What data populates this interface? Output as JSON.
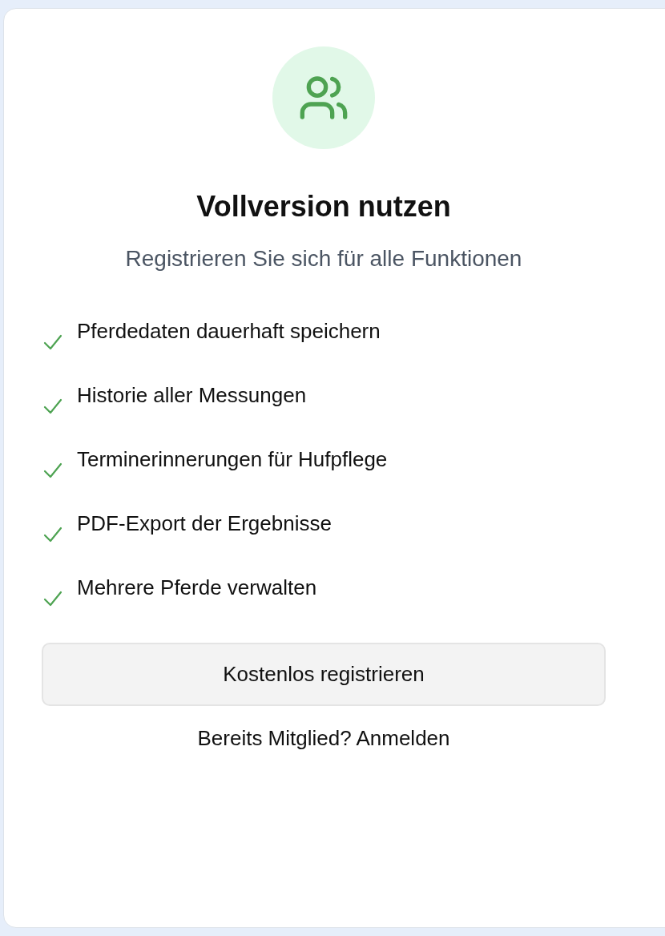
{
  "title": "Vollversion nutzen",
  "subtitle": "Registrieren Sie sich für alle Funktionen",
  "features": [
    {
      "label": "Pferdedaten dauerhaft speichern"
    },
    {
      "label": "Historie aller Messungen"
    },
    {
      "label": "Terminerinnerungen für Hufpflege"
    },
    {
      "label": "PDF-Export der Ergebnisse"
    },
    {
      "label": "Mehrere Pferde verwalten"
    }
  ],
  "register_button": "Kostenlos registrieren",
  "login_link": "Bereits Mitglied? Anmelden"
}
